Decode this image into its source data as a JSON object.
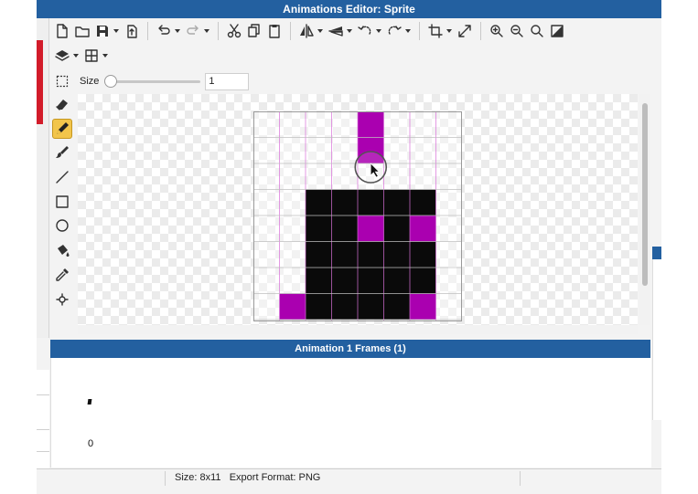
{
  "window": {
    "title": "Animations Editor: Sprite"
  },
  "toolbar": {
    "row1": [
      {
        "name": "new-file-icon"
      },
      {
        "name": "open-folder-icon"
      },
      {
        "name": "save-icon",
        "dropdown": true
      },
      {
        "name": "export-icon"
      },
      {
        "sep": true
      },
      {
        "name": "undo-icon",
        "dropdown": true
      },
      {
        "name": "redo-icon",
        "dropdown": true
      },
      {
        "sep": true
      },
      {
        "name": "cut-icon"
      },
      {
        "name": "copy-icon"
      },
      {
        "name": "paste-icon"
      },
      {
        "sep": true
      },
      {
        "name": "flip-horizontal-icon",
        "dropdown": true
      },
      {
        "name": "flip-vertical-icon",
        "dropdown": true
      },
      {
        "name": "rotate-left-icon",
        "dropdown": true
      },
      {
        "name": "rotate-right-icon",
        "dropdown": true
      },
      {
        "sep": true
      },
      {
        "name": "crop-icon",
        "dropdown": true
      },
      {
        "name": "resize-icon"
      },
      {
        "sep": true
      },
      {
        "name": "zoom-in-icon"
      },
      {
        "name": "zoom-out-icon"
      },
      {
        "name": "zoom-fit-icon"
      },
      {
        "name": "transparency-icon"
      }
    ],
    "row2": [
      {
        "name": "layers-icon",
        "dropdown": true
      },
      {
        "name": "grid-icon",
        "dropdown": true
      }
    ]
  },
  "brush": {
    "label": "Size",
    "value": "1"
  },
  "tools": [
    {
      "name": "eraser-icon",
      "active": false
    },
    {
      "name": "pencil-icon",
      "active": true
    },
    {
      "name": "brush-icon",
      "active": false
    },
    {
      "name": "line-icon",
      "active": false
    },
    {
      "name": "rectangle-icon",
      "active": false
    },
    {
      "name": "ellipse-icon",
      "active": false
    },
    {
      "name": "fill-bucket-icon",
      "active": false
    },
    {
      "name": "eyedropper-icon",
      "active": false
    },
    {
      "name": "anchor-point-icon",
      "active": false
    }
  ],
  "sprite": {
    "colors": {
      "M": "#aa00b0",
      "K": "#0a0a0a"
    },
    "rows": [
      "....M...",
      "....M...",
      "........",
      "..KKKKK.",
      "..KKMKM.",
      "..KKKKK.",
      "..KKKKK.",
      ".MKKKKM."
    ]
  },
  "frames_panel": {
    "title": "Animation 1 Frames (1)",
    "frames": [
      {
        "index": "0"
      }
    ]
  },
  "status": {
    "text": "Size: 8x11   Export Format: PNG"
  },
  "colors": {
    "accent": "#2360a0",
    "active_tool": "#f2c54b",
    "grid_line": "#d870d8"
  }
}
